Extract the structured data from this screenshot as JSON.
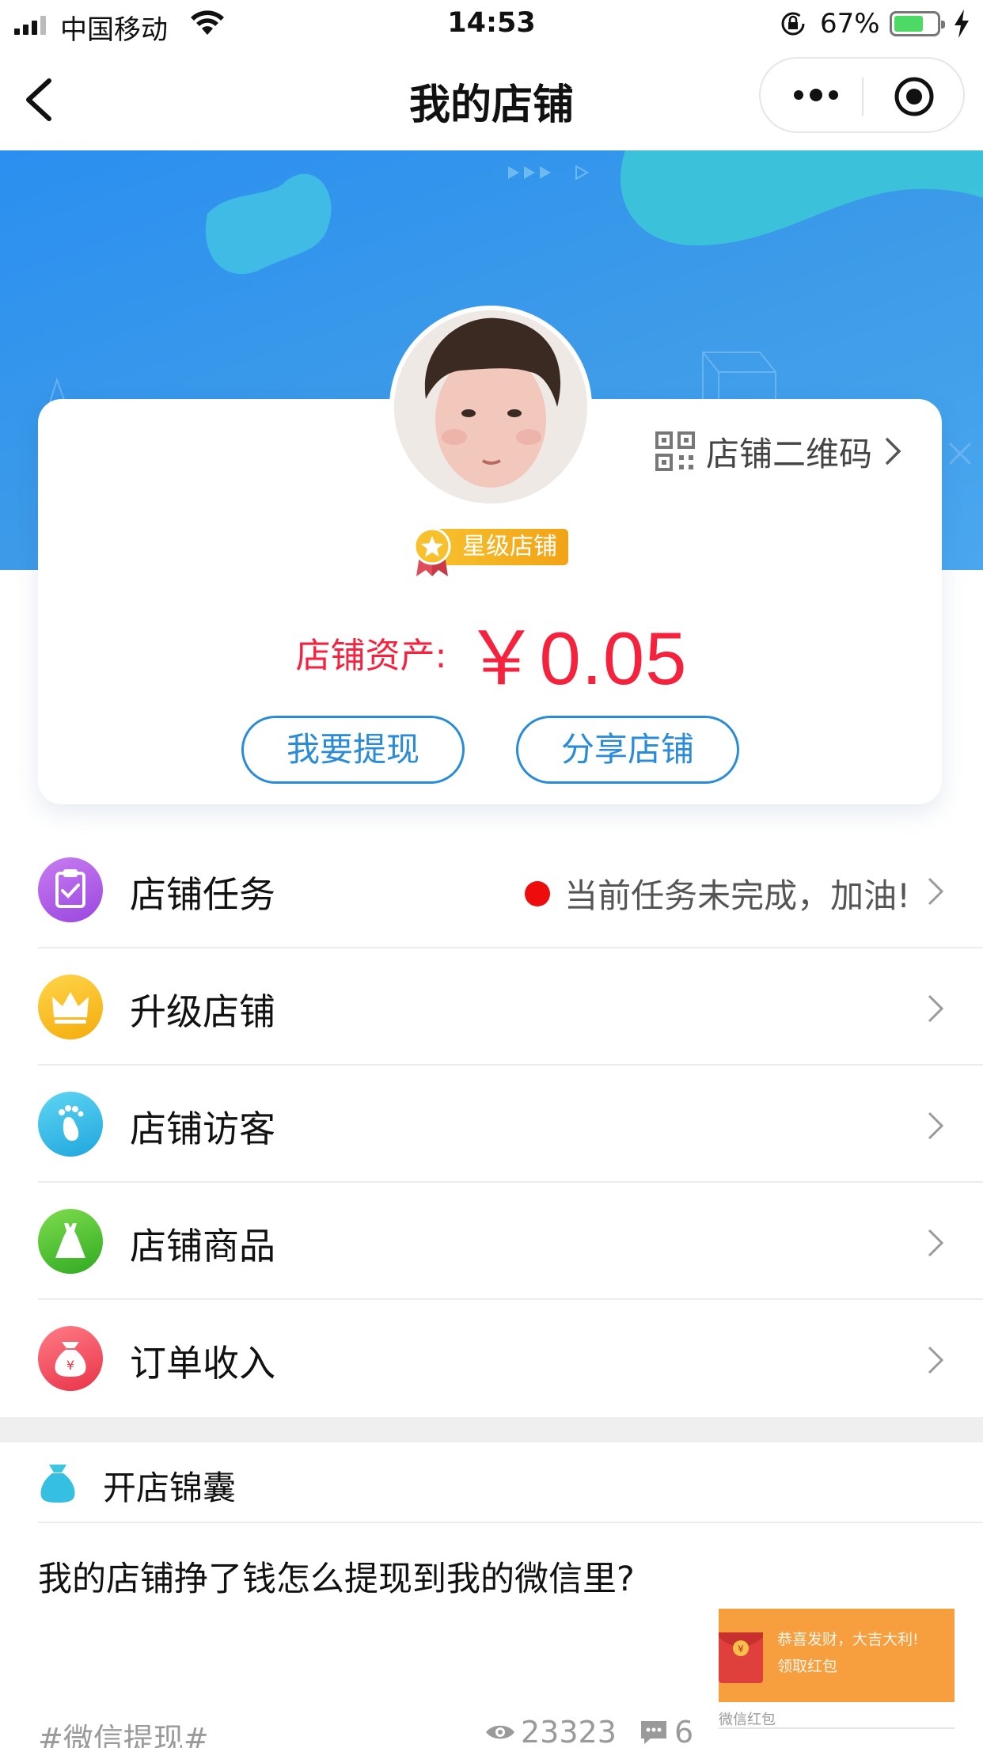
{
  "status_bar": {
    "carrier": "中国移动",
    "time": "14:53",
    "battery_percent": "67%",
    "battery_level": 0.67
  },
  "nav": {
    "title": "我的店铺",
    "icons": [
      "back-arrow-icon",
      "more-dots-icon",
      "close-target-icon"
    ]
  },
  "shop_card": {
    "qr_label": "店铺二维码",
    "badge": "星级店铺",
    "assets_label": "店铺资产:",
    "assets_value": "￥0.05",
    "withdraw_button": "我要提现",
    "share_button": "分享店铺"
  },
  "menu": [
    {
      "label": "店铺任务",
      "status": "当前任务未完成，加油!",
      "icon": "clipboard-check-icon",
      "color": "#a04fe6"
    },
    {
      "label": "升级店铺",
      "status": "",
      "icon": "crown-icon",
      "color": "#f6b613"
    },
    {
      "label": "店铺访客",
      "status": "",
      "icon": "footprint-icon",
      "color": "#2fb9e8"
    },
    {
      "label": "店铺商品",
      "status": "",
      "icon": "dress-icon",
      "color": "#46c42f"
    },
    {
      "label": "订单收入",
      "status": "",
      "icon": "money-bag-icon",
      "color": "#ef4a5d"
    }
  ],
  "tips": {
    "title": "开店锦囊",
    "question": "我的店铺挣了钱怎么提现到我的微信里?",
    "tag": "#微信提现#",
    "views": "23323",
    "comments": "6"
  },
  "ad": {
    "line1": "恭喜发财，大吉大利!",
    "line2": "领取红包",
    "footer": "微信红包"
  },
  "colors": {
    "accent_blue": "#2a8bd8",
    "price_red": "#f5223d",
    "banner_blue": "#2a8ff0"
  }
}
